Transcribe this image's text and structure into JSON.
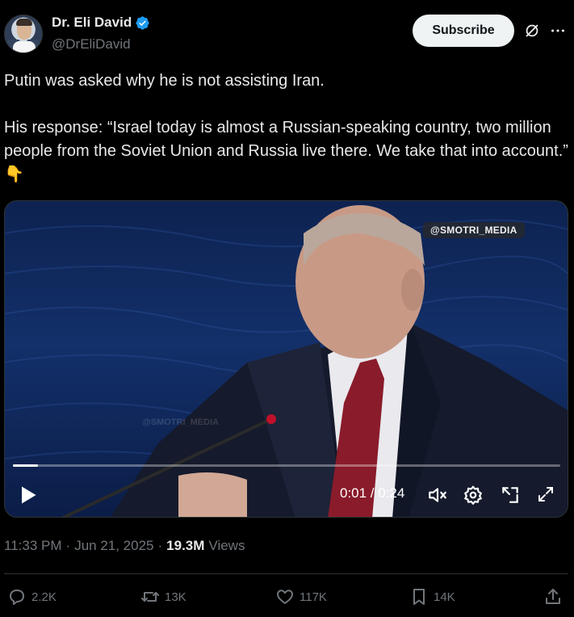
{
  "author": {
    "display_name": "Dr. Eli David",
    "handle": "@DrEliDavid",
    "verified": true,
    "avatar_icon": "avatar-photo"
  },
  "header": {
    "subscribe_label": "Subscribe",
    "grok_icon": "grok-icon",
    "more_icon": "more-icon"
  },
  "tweet": {
    "text": "Putin was asked why he is not assisting Iran.\n\nHis response: “Israel today is almost a Russian-speaking country, two million people from the Soviet Union and Russia live there. We take that into account.” 👇"
  },
  "video": {
    "watermark": "@SMOTRI_MEDIA",
    "watermark_faint": "@SMOTRI_MEDIA",
    "time_display": "0:01 / 0:24",
    "progress_fraction": 0.045,
    "controls": [
      "play-icon",
      "mute-icon",
      "settings-icon",
      "pip-icon",
      "fullscreen-icon"
    ]
  },
  "meta": {
    "time": "11:33 PM",
    "separator": "·",
    "date": "Jun 21, 2025",
    "views_count": "19.3M",
    "views_label": "Views"
  },
  "actions": {
    "replies": "2.2K",
    "reposts": "13K",
    "likes": "117K",
    "bookmarks": "14K"
  },
  "colors": {
    "background": "#000000",
    "text": "#e7e9ea",
    "muted": "#71767b",
    "verified": "#1d9bf0",
    "divider": "#2f3336"
  }
}
